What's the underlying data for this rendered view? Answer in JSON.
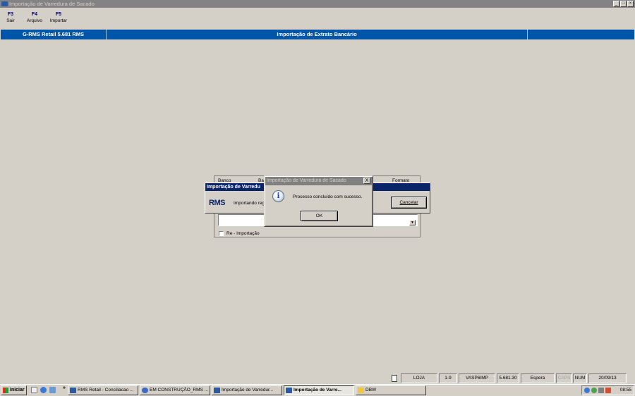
{
  "window": {
    "title": "Importação de Varredura de Sacado",
    "controls": [
      "minimize-icon",
      "maximize-icon",
      "close-icon"
    ]
  },
  "fkeys": [
    {
      "key": "F3",
      "label": "Sair"
    },
    {
      "key": "F4",
      "label": "Arquivo"
    },
    {
      "key": "F5",
      "label": "Importar"
    }
  ],
  "header": {
    "product": "G-RMS Retail 5.681 RMS",
    "screen_title": "Importação de Extrato Bancário"
  },
  "form": {
    "col_banco": "Banco",
    "col_ba": "Ba",
    "col_formato": "Formato",
    "reimport_label": "Re - Importação",
    "reimport_checked": false
  },
  "progress_dialog": {
    "title": "Importação de Varredu",
    "logo": "RMS",
    "message": "Importando reg",
    "cancel_label": "Cancelar"
  },
  "message_box": {
    "title": "Importação de Varredura de Sacado",
    "close_glyph": "X",
    "icon": "info-icon",
    "text": "Processo concluído com sucesso.",
    "ok_label": "OK"
  },
  "statusbar": {
    "loja": "LOJA",
    "range": "1-9",
    "program": "VASP6IMP",
    "version": "5.681.30",
    "status": "Espera",
    "caps": "CAPS",
    "num": "NUM",
    "date": "20/09/13"
  },
  "taskbar": {
    "start_label": "Iniciar",
    "chevron": "»",
    "items": [
      {
        "label": "RMS Retail - Conciliacao ...",
        "active": false
      },
      {
        "label": "EM CONSTRUÇÃO_RMS ...",
        "active": false
      },
      {
        "label": "Importação de Varredur...",
        "active": false
      },
      {
        "label": "Importação de Varre...",
        "active": true
      },
      {
        "label": "DBW",
        "active": false
      }
    ],
    "clock": "08:55"
  }
}
